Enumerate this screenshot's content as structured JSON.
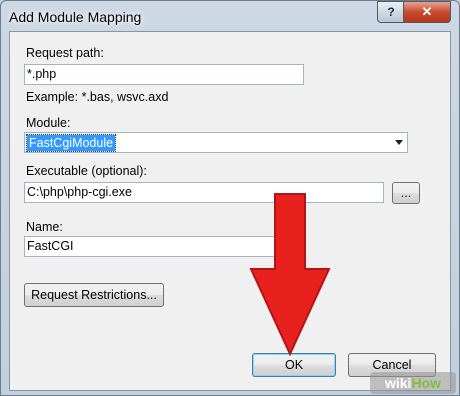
{
  "dialog": {
    "title": "Add Module Mapping",
    "help_glyph": "?",
    "close_glyph": "✕"
  },
  "form": {
    "request_path_label": "Request path:",
    "request_path_value": "*.php",
    "example_text": "Example: *.bas, wsvc.axd",
    "module_label": "Module:",
    "module_value": "FastCgiModule",
    "executable_label": "Executable (optional):",
    "executable_value": "C:\\php\\php-cgi.exe",
    "browse_label": "...",
    "name_label": "Name:",
    "name_value": "FastCGI"
  },
  "buttons": {
    "request_restrictions": "Request Restrictions...",
    "ok": "OK",
    "cancel": "Cancel"
  },
  "annotation": {
    "arrow_color": "#e8201e"
  },
  "watermark": {
    "wiki": "wiki",
    "how": "How"
  }
}
